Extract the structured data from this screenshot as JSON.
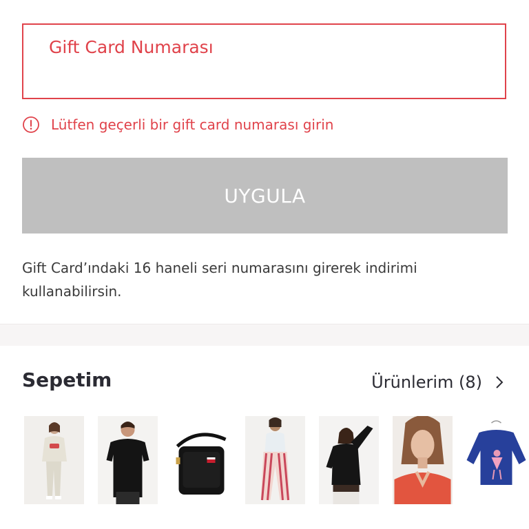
{
  "gift_card": {
    "label": "Gift Card Numarası",
    "value": "",
    "error": "Lütfen geçerli bir gift card numarası girin"
  },
  "apply_button": {
    "label": "UYGULA"
  },
  "help_text": "Gift Card’ındaki 16 haneli seri numarasını girerek indirimi kullanabilirsin.",
  "cart": {
    "title": "Sepetim",
    "link_label": "Ürünlerim (8)",
    "thumbnails": [
      "kids-sweatsuit",
      "black-polo-tshirt",
      "black-crossbody-bag",
      "striped-trousers-outfit",
      "black-long-sleeve-top",
      "red-vneck-sweater",
      "blue-kids-sweatshirt"
    ]
  },
  "colors": {
    "error": "#e0424a",
    "button_disabled": "#bfbfbf",
    "text": "#2b2b33"
  }
}
